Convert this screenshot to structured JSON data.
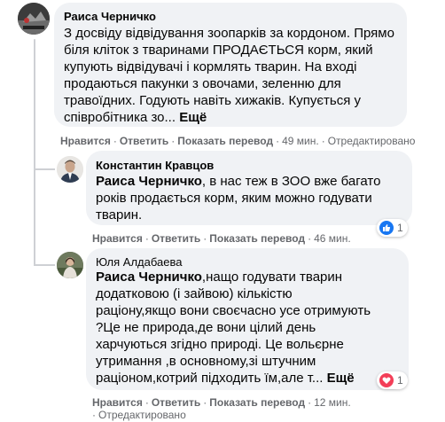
{
  "comments": [
    {
      "author": "Раиса Черничко",
      "lines": [
        "З досвіду відвідування зоопарків за кордоном. Прямо",
        "біля кліток з тваринами ПРОДАЄТЬСЯ корм, який",
        "купують відвідувачі і кормлять тварин. На вході",
        "продаються пакунки з овочами, зеленню для",
        "травоїдних. Годують навіть хижаків. Купується у",
        "співробітника зо..."
      ],
      "more": "Ещё",
      "actions": {
        "like": "Нравится",
        "reply": "Ответить",
        "translate": "Показать перевод",
        "time": "49 мин.",
        "edited": "Отредактировано"
      }
    },
    {
      "author": "Константин Кравцов",
      "mention": "Раиса Черничко",
      "lines": [
        ", в нас теж в ЗОО вже багато",
        "років продається корм, яким можно годувати",
        "тварин."
      ],
      "actions": {
        "like": "Нравится",
        "reply": "Ответить",
        "translate": "Показать перевод",
        "time": "46 мин."
      },
      "reactions": {
        "icons": [
          "like-icon"
        ],
        "count": "1"
      }
    },
    {
      "author": "Юля Алдабаева",
      "mention": "Раиса Черничко",
      "lines": [
        ",нащо годувати тварин",
        "додатковою (і зайвою) кількістю",
        "раціону,якщо вони своєчасно усе отримують",
        "?Це не природа,де вони цілий день",
        "харчуються згідно природі. Це вольєрне",
        "утримання ,в основному,зі штучним",
        "раціоном,котрий підходить їм,але т..."
      ],
      "more": "Ещё",
      "actions": {
        "like": "Нравится",
        "reply": "Ответить",
        "translate": "Показать перевод",
        "time": "12 мин.",
        "edited": "Отредактировано"
      },
      "reactions": {
        "icons": [
          "love-icon"
        ],
        "count": "1"
      }
    }
  ],
  "colors": {
    "bubble": "#f0f2f5",
    "meta": "#65676b",
    "like": "#1877f2",
    "love": "#f33e58"
  }
}
